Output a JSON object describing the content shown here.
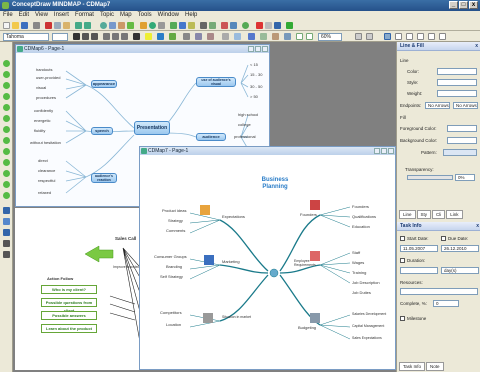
{
  "window": {
    "title": "ConceptDraw MINDMAP - CDMap7"
  },
  "menu": [
    "File",
    "Edit",
    "View",
    "Insert",
    "Format",
    "Topic",
    "Map",
    "Tools",
    "Window",
    "Help"
  ],
  "toolbar": {
    "font": "Tahoma",
    "zoom": "60%"
  },
  "map6": {
    "title": "CDMap6 - Page-1",
    "central": "Presentation",
    "main": [
      "appearance",
      "speech",
      "audience's reaction",
      "use of audience's visual",
      "audience"
    ],
    "leaves": [
      "handouts",
      "user-provided",
      "visual",
      "procedures",
      "confidently",
      "energetic",
      "fluidity",
      "without hesitation",
      "direct",
      "clearance",
      "respectful",
      "relaxed",
      "< 15",
      "15 - 30",
      "30 - 50",
      "> 50",
      "high school",
      "college",
      "professional",
      "reviewer"
    ]
  },
  "map5": {
    "center": "Sales Call",
    "left": "Action Follow",
    "items": [
      "Who is my client?",
      "Possible questions from client",
      "Possible answers",
      "Learn about the product"
    ],
    "extra": "Improve knowledge base"
  },
  "map7": {
    "title": "CDMap7 - Page-1",
    "heading1": "Business",
    "heading2": "Planning",
    "topics": [
      "Expectations",
      "Marketing",
      "Situation in market",
      "Founders",
      "Employee Requirements",
      "Budgeting"
    ],
    "leaves": [
      "Product ideas",
      "Strategy",
      "Comments",
      "Consumer Groups",
      "Branding",
      "Self Strategy",
      "Competitors",
      "Location",
      "Founders",
      "Qualifications",
      "Education",
      "Staff",
      "Wages",
      "Training",
      "Job Description",
      "Job Duties",
      "Salaries Development",
      "Capital Management",
      "Sales Expectations"
    ]
  },
  "line_fill": {
    "title": "Line & Fill",
    "line_label": "Line",
    "color": "Color:",
    "style": "Style:",
    "weight": "Weight:",
    "endpoints": "Endpoints:",
    "ep1": "No Arrows",
    "ep2": "No Arrows",
    "fill_label": "Fill",
    "fg": "Foreground Color:",
    "bg": "Background Color:",
    "pattern": "Pattern:",
    "transparency": "Transparency:",
    "transparency_value": "0%"
  },
  "panel_tabs": [
    "Line",
    "Sty",
    "Cli",
    "Link"
  ],
  "task": {
    "title": "Task Info",
    "start": "Start Date:",
    "due": "Due Date:",
    "start_val": "11.05.2007",
    "due_val": "26.12.2010",
    "duration": "Duration:",
    "duration_unit": "day(s)",
    "resources": "Resources:",
    "complete": "Complete, %:",
    "complete_val": "0",
    "milestone": "Milestone"
  },
  "bottom_tabs": [
    "Task Info",
    "Note"
  ]
}
